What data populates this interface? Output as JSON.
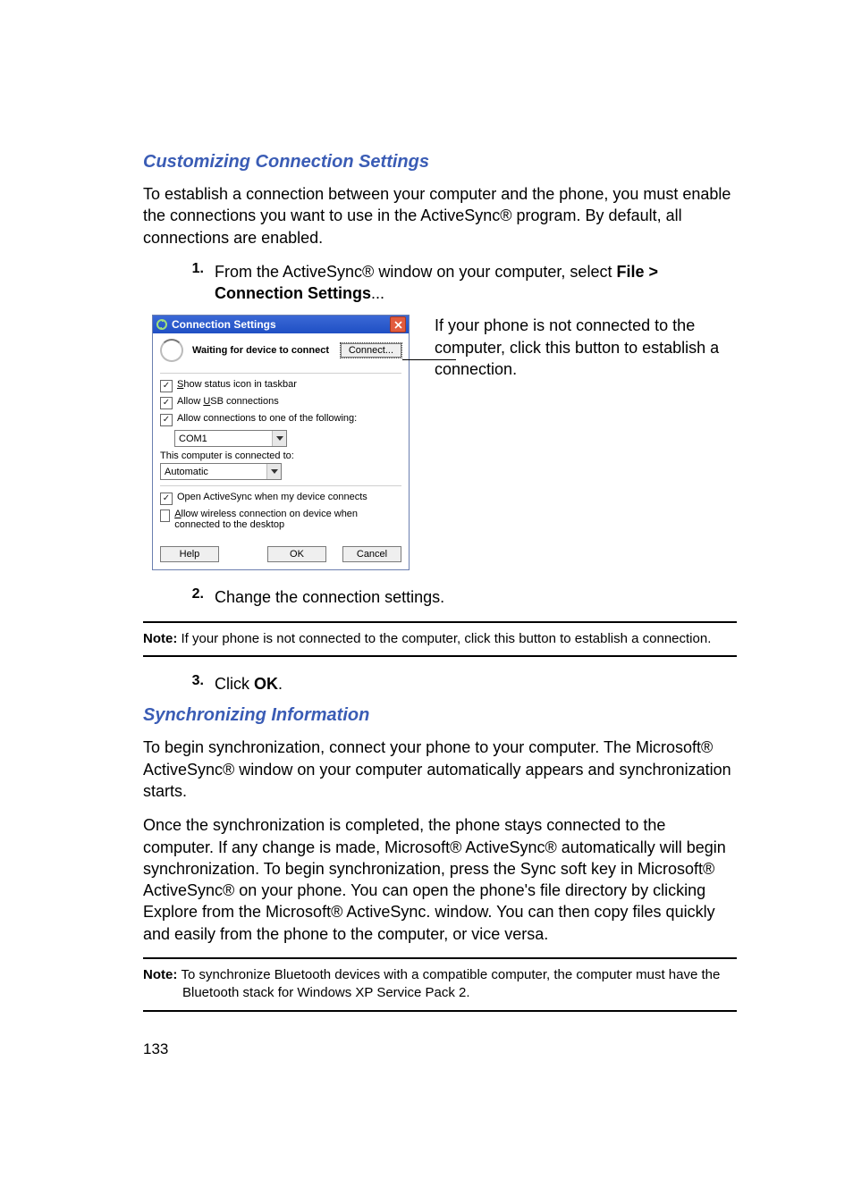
{
  "headings": {
    "h1": "Customizing Connection Settings",
    "h2": "Synchronizing Information"
  },
  "p_intro": "To establish a connection between your computer and the phone, you must enable the connections you want to use in the ActiveSync® program. By default, all connections are enabled.",
  "step1": {
    "n": "1.",
    "pre": "From the ActiveSync® window on your computer, select ",
    "b1": "File > Connection Settings",
    "post": "..."
  },
  "callout": "If your phone is not connected to the computer, click this button to establish a connection.",
  "dialog": {
    "title": "Connection Settings",
    "waiting": "Waiting for device to connect",
    "connect_btn": "Connect...",
    "chk_status_pre": "S",
    "chk_status_post": "how status icon in taskbar",
    "chk_usb_pre": "Allow ",
    "chk_usb_u": "U",
    "chk_usb_post": "SB connections",
    "chk_com": "Allow connections to one of the following:",
    "combo_com": "COM1",
    "lbl_computer": "This computer is connected to:",
    "combo_net": "Automatic",
    "chk_open": "Open ActiveSync when my device connects",
    "chk_wireless_u": "A",
    "chk_wireless_post": "llow wireless connection on device when connected to the desktop",
    "btn_help_u": "H",
    "btn_help_post": "elp",
    "btn_ok": "OK",
    "btn_cancel": "Cancel"
  },
  "step2": {
    "n": "2.",
    "t": "Change the connection settings."
  },
  "note1": {
    "lead": "Note: ",
    "t": "If your phone is not connected to the computer, click this button to establish a connection."
  },
  "step3": {
    "n": "3.",
    "pre": "Click ",
    "b": "OK",
    "post": "."
  },
  "p_sync1": "To begin synchronization, connect your phone to your computer. The Microsoft® ActiveSync® window on your computer automatically appears and synchronization starts.",
  "p_sync2": "Once the synchronization is completed, the phone stays connected to the computer. If any change is made, Microsoft® ActiveSync® automatically will begin synchronization. To begin synchronization, press the Sync soft key in Microsoft® ActiveSync® on your phone. You can open the phone's file directory by clicking Explore from the Microsoft® ActiveSync. window. You can then copy files quickly and easily from the phone to the computer, or vice versa.",
  "note2": {
    "lead": "Note: ",
    "t1": "To synchronize Bluetooth devices with a compatible computer, the computer must have the",
    "t2": "Bluetooth stack for Windows XP Service Pack 2."
  },
  "page_no": "133"
}
